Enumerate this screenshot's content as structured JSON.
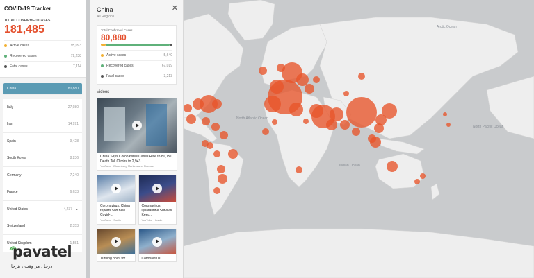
{
  "app": {
    "title": "COVID-19 Tracker"
  },
  "summary": {
    "total_label": "TOTAL CONFIRMED CASES",
    "total_value": "181,485",
    "stats": [
      {
        "label": "Active cases",
        "value": "95,093",
        "color": "#f2b134"
      },
      {
        "label": "Recovered cases",
        "value": "79,238",
        "color": "#5fb17a"
      },
      {
        "label": "Fatal cases",
        "value": "7,114",
        "color": "#555555"
      }
    ]
  },
  "countries": [
    {
      "name": "China",
      "value": "80,880",
      "selected": true
    },
    {
      "name": "Italy",
      "value": "27,980"
    },
    {
      "name": "Iran",
      "value": "14,991"
    },
    {
      "name": "Spain",
      "value": "9,428"
    },
    {
      "name": "South Korea",
      "value": "8,236"
    },
    {
      "name": "Germany",
      "value": "7,240"
    },
    {
      "name": "France",
      "value": "6,633"
    },
    {
      "name": "United States",
      "value": "4,237",
      "expand": "⌄"
    },
    {
      "name": "Switzerland",
      "value": "2,353"
    },
    {
      "name": "United Kingdom",
      "value": "1,551"
    }
  ],
  "detail": {
    "title": "China",
    "subtitle": "All Regions",
    "close_icon": "✕",
    "total_label": "Total Confirmed Cases",
    "total_value": "80,880",
    "progress": {
      "active": 0.07,
      "recovered": 0.89,
      "fatal": 0.04
    },
    "stats": [
      {
        "label": "Active cases",
        "value": "5,640",
        "color": "#f2b134"
      },
      {
        "label": "Recovered cases",
        "value": "67,019",
        "color": "#5fb17a"
      },
      {
        "label": "Fatal cases",
        "value": "3,213",
        "color": "#555555"
      }
    ],
    "videos_label": "Videos",
    "videos": [
      {
        "title": "China Says Coronavirus Cases Rise to 80,151, Death Toll Climbs to 2,943",
        "source": "YouTube · Bloomberg Markets and Finance"
      },
      {
        "title": "Coronavirus: China reports 508 new Covid-...",
        "source": "YouTube · South"
      },
      {
        "title": "Coronavirus Quarantine Survivor Keep...",
        "source": "YouTube · Inside"
      },
      {
        "title": "Turning point for",
        "source": ""
      },
      {
        "title": "Coronavirus",
        "source": ""
      }
    ]
  },
  "map_labels": [
    {
      "text": "North Atlantic Ocean"
    },
    {
      "text": "Indian Ocean"
    },
    {
      "text": "Arctic Ocean"
    },
    {
      "text": "North Pacific Ocean"
    }
  ],
  "logo": {
    "brand": "pavatel",
    "tagline": "درجا ، هر وقت ، هرجا"
  },
  "colors": {
    "accent": "#e4502e",
    "selected": "#5b9bb4",
    "bubble": "#e8542a"
  }
}
